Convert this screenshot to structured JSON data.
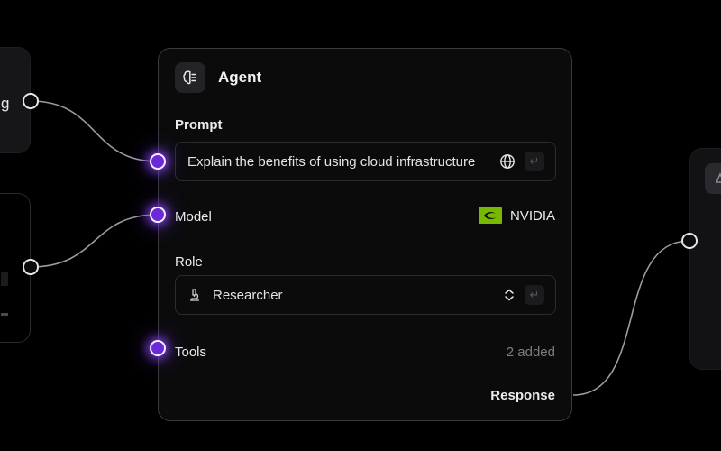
{
  "left_nodes": {
    "top_node_text_fragment": "g"
  },
  "agent_node": {
    "title": "Agent",
    "icon": "brain-icon",
    "prompt": {
      "label": "Prompt",
      "value": "Explain the benefits of using cloud infrastructure",
      "trailing_icons": [
        "globe-icon",
        "enter-icon"
      ]
    },
    "model": {
      "label": "Model",
      "value": "NVIDIA",
      "icon": "nvidia-logo-icon",
      "brand_color": "#76b900"
    },
    "role": {
      "label": "Role",
      "value": "Researcher",
      "icon": "microscope-icon",
      "trailing_icons": [
        "chevron-updown-icon",
        "enter-icon"
      ]
    },
    "tools": {
      "label": "Tools",
      "value": "2 added"
    },
    "response": {
      "label": "Response"
    }
  },
  "right_node": {
    "icon": "node-icon"
  },
  "colors": {
    "background": "#000000",
    "card_border": "#3a3a3f",
    "active_port": "#7c3aed",
    "edge": "#8a8a90"
  }
}
